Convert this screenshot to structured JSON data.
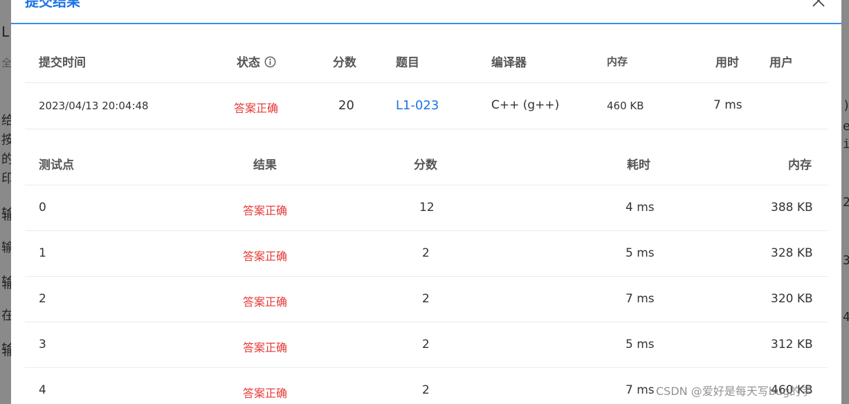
{
  "dialog": {
    "title": "提交结果"
  },
  "background": {
    "left_chars": [
      "L",
      "全",
      "给",
      "按",
      "的",
      "印",
      "输",
      "输",
      "输",
      "在",
      "输"
    ],
    "right_chars": [
      ")",
      "e",
      "i",
      "2",
      "3",
      "4"
    ]
  },
  "submission": {
    "headers": {
      "time": "提交时间",
      "status": "状态",
      "score": "分数",
      "problem": "题目",
      "compiler": "编译器",
      "memory": "内存",
      "time_used": "用时",
      "user": "用户"
    },
    "row": {
      "time": "2023/04/13 20:04:48",
      "status": "答案正确",
      "score": "20",
      "problem": "L1-023",
      "compiler": "C++ (g++)",
      "memory": "460 KB",
      "time_used": "7 ms",
      "user": ""
    }
  },
  "testcases": {
    "headers": {
      "id": "测试点",
      "result": "结果",
      "score": "分数",
      "time": "耗时",
      "memory": "内存"
    },
    "rows": [
      {
        "id": "0",
        "result": "答案正确",
        "score": "12",
        "time": "4 ms",
        "memory": "388 KB"
      },
      {
        "id": "1",
        "result": "答案正确",
        "score": "2",
        "time": "5 ms",
        "memory": "328 KB"
      },
      {
        "id": "2",
        "result": "答案正确",
        "score": "2",
        "time": "7 ms",
        "memory": "320 KB"
      },
      {
        "id": "3",
        "result": "答案正确",
        "score": "2",
        "time": "5 ms",
        "memory": "312 KB"
      },
      {
        "id": "4",
        "result": "答案正确",
        "score": "2",
        "time": "7 ms",
        "memory": "460 KB"
      }
    ]
  },
  "watermark": "CSDN @爱好是每天写bug的宇",
  "colors": {
    "accent": "#1a73e8",
    "success_text": "#e53935",
    "overlay": "#8a8a8a"
  }
}
